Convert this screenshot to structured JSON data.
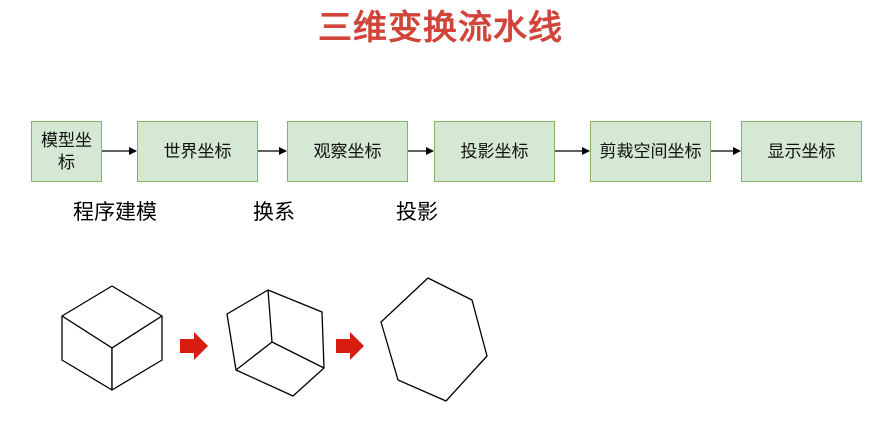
{
  "title": "三维变换流水线",
  "pipeline": {
    "stages": [
      "模型坐标",
      "世界坐标",
      "观察坐标",
      "投影坐标",
      "剪裁空间坐标",
      "显示坐标"
    ],
    "captions": [
      "程序建模",
      "换系",
      "投影"
    ]
  },
  "colors": {
    "title": "#d0443a",
    "box_fill": "#d5e8d4",
    "box_border": "#82b366",
    "big_arrow": "#d81c10"
  },
  "figures": [
    "cube-icon",
    "rotated-cube-icon",
    "hexagon-projection-icon"
  ]
}
